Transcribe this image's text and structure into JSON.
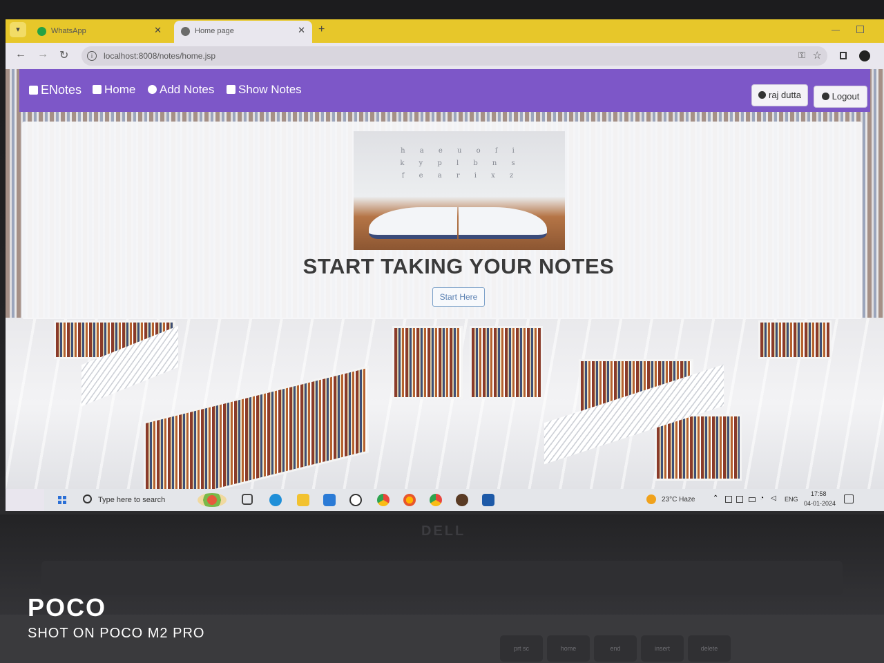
{
  "browser": {
    "tabs": [
      {
        "label": "WhatsApp",
        "active": false
      },
      {
        "label": "Home page",
        "active": true
      }
    ],
    "new_tab_symbol": "+",
    "url": "localhost:8008/notes/home.jsp",
    "tab_bar_color": "#e7c72a"
  },
  "navbar": {
    "brand": "ENotes",
    "links": [
      "Home",
      "Add Notes",
      "Show Notes"
    ],
    "user_button": "raj dutta",
    "logout_button": "Logout",
    "color": "#7d57c8"
  },
  "hero": {
    "title": "START TAKING YOUR NOTES",
    "button": "Start Here"
  },
  "taskbar": {
    "search_placeholder": "Type here to search",
    "weather": "23°C  Haze",
    "language": "ENG",
    "time": "17:58",
    "date": "04-01-2024",
    "apps": [
      "task-view-icon",
      "edge-icon",
      "file-explorer-icon",
      "mail-icon",
      "dell-icon",
      "chrome-icon",
      "firefox-icon",
      "chrome-profile-icon",
      "app-icon",
      "vscode-icon"
    ]
  },
  "photo": {
    "watermark_brand": "POCO",
    "watermark_sub": "SHOT ON POCO M2 PRO",
    "laptop_logo": "DELL",
    "keys": [
      "prt sc",
      "home",
      "end",
      "insert",
      "delete"
    ]
  }
}
